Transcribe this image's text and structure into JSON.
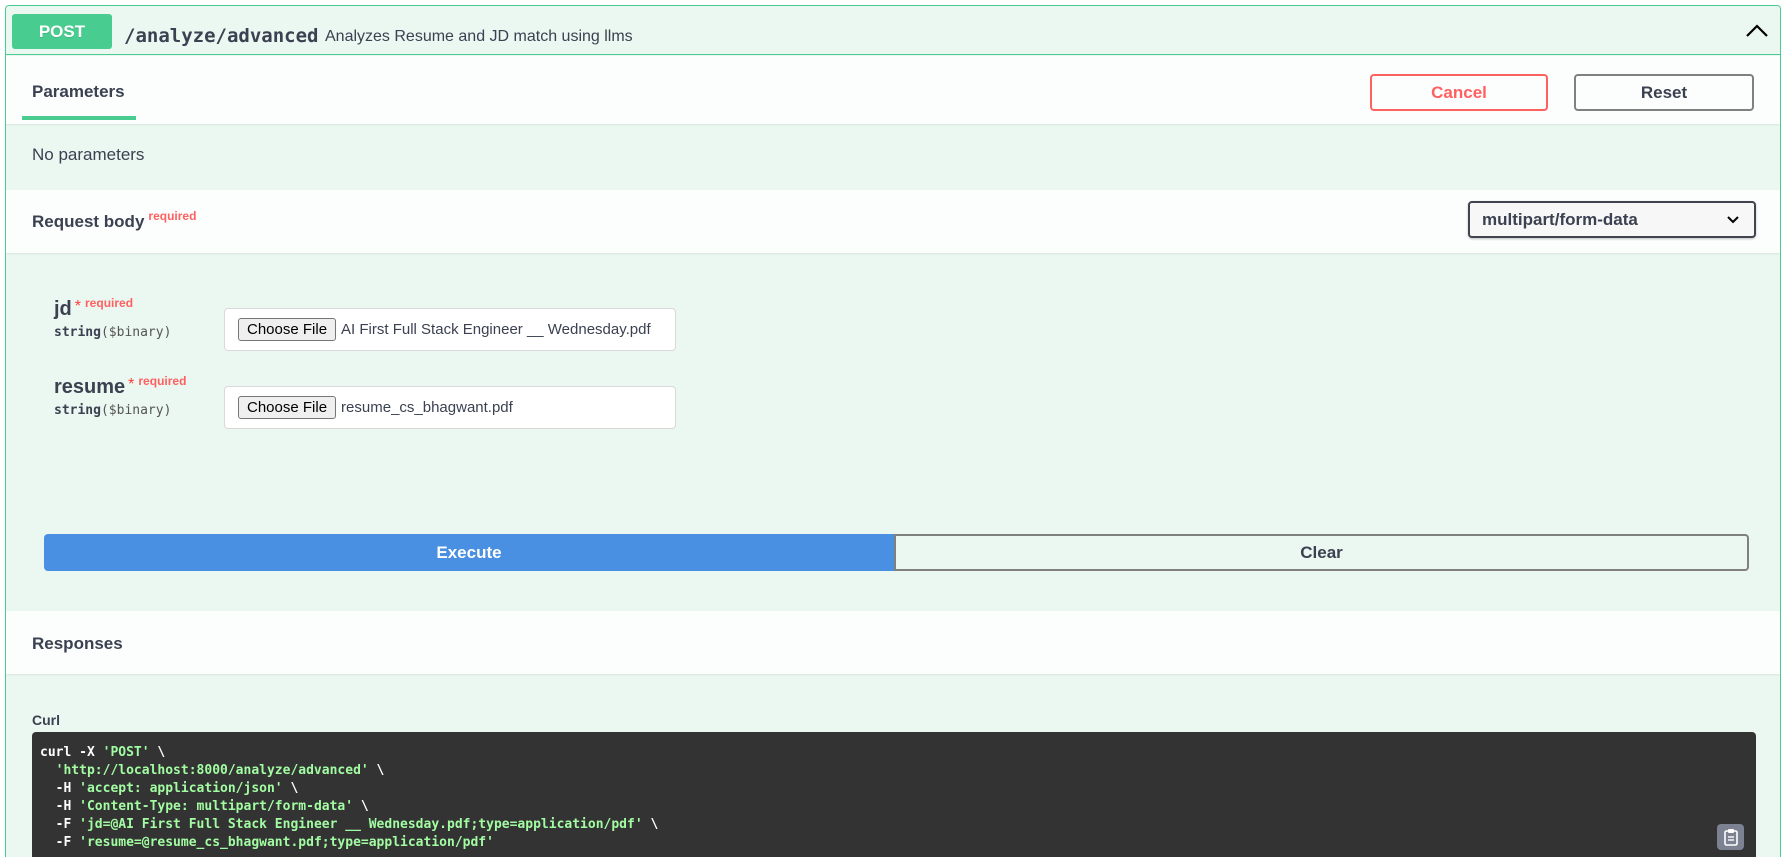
{
  "summary": {
    "method": "POST",
    "path": "/analyze/advanced",
    "description": "Analyzes Resume and JD match using llms",
    "accent_color": "#49cc90"
  },
  "parameters": {
    "tab_label": "Parameters",
    "cancel_label": "Cancel",
    "reset_label": "Reset",
    "empty_text": "No parameters"
  },
  "request_body": {
    "title": "Request body",
    "required_label": "required",
    "content_type": "multipart/form-data",
    "fields": [
      {
        "name": "jd",
        "star": "*",
        "required_label": "required",
        "type": "string",
        "format": "($binary)",
        "button_label": "Choose File",
        "file_name": "AI First Full Stack Engineer __ Wednesday.pdf"
      },
      {
        "name": "resume",
        "star": "*",
        "required_label": "required",
        "type": "string",
        "format": "($binary)",
        "button_label": "Choose File",
        "file_name": "resume_cs_bhagwant.pdf"
      }
    ]
  },
  "actions": {
    "execute_label": "Execute",
    "clear_label": "Clear",
    "execute_color": "#4990e2"
  },
  "responses": {
    "title": "Responses",
    "curl_label": "Curl",
    "curl_lines": [
      {
        "plain": "curl -X ",
        "str": "'POST'",
        "tail": " \\"
      },
      {
        "plain": "  ",
        "str": "'http://localhost:8000/analyze/advanced'",
        "tail": " \\"
      },
      {
        "plain": "  -H ",
        "str": "'accept: application/json'",
        "tail": " \\"
      },
      {
        "plain": "  -H ",
        "str": "'Content-Type: multipart/form-data'",
        "tail": " \\"
      },
      {
        "plain": "  -F ",
        "str": "'jd=@AI First Full Stack Engineer __ Wednesday.pdf;type=application/pdf'",
        "tail": " \\"
      },
      {
        "plain": "  -F ",
        "str": "'resume=@resume_cs_bhagwant.pdf;type=application/pdf'",
        "tail": ""
      }
    ],
    "copy_icon": "clipboard-icon"
  }
}
